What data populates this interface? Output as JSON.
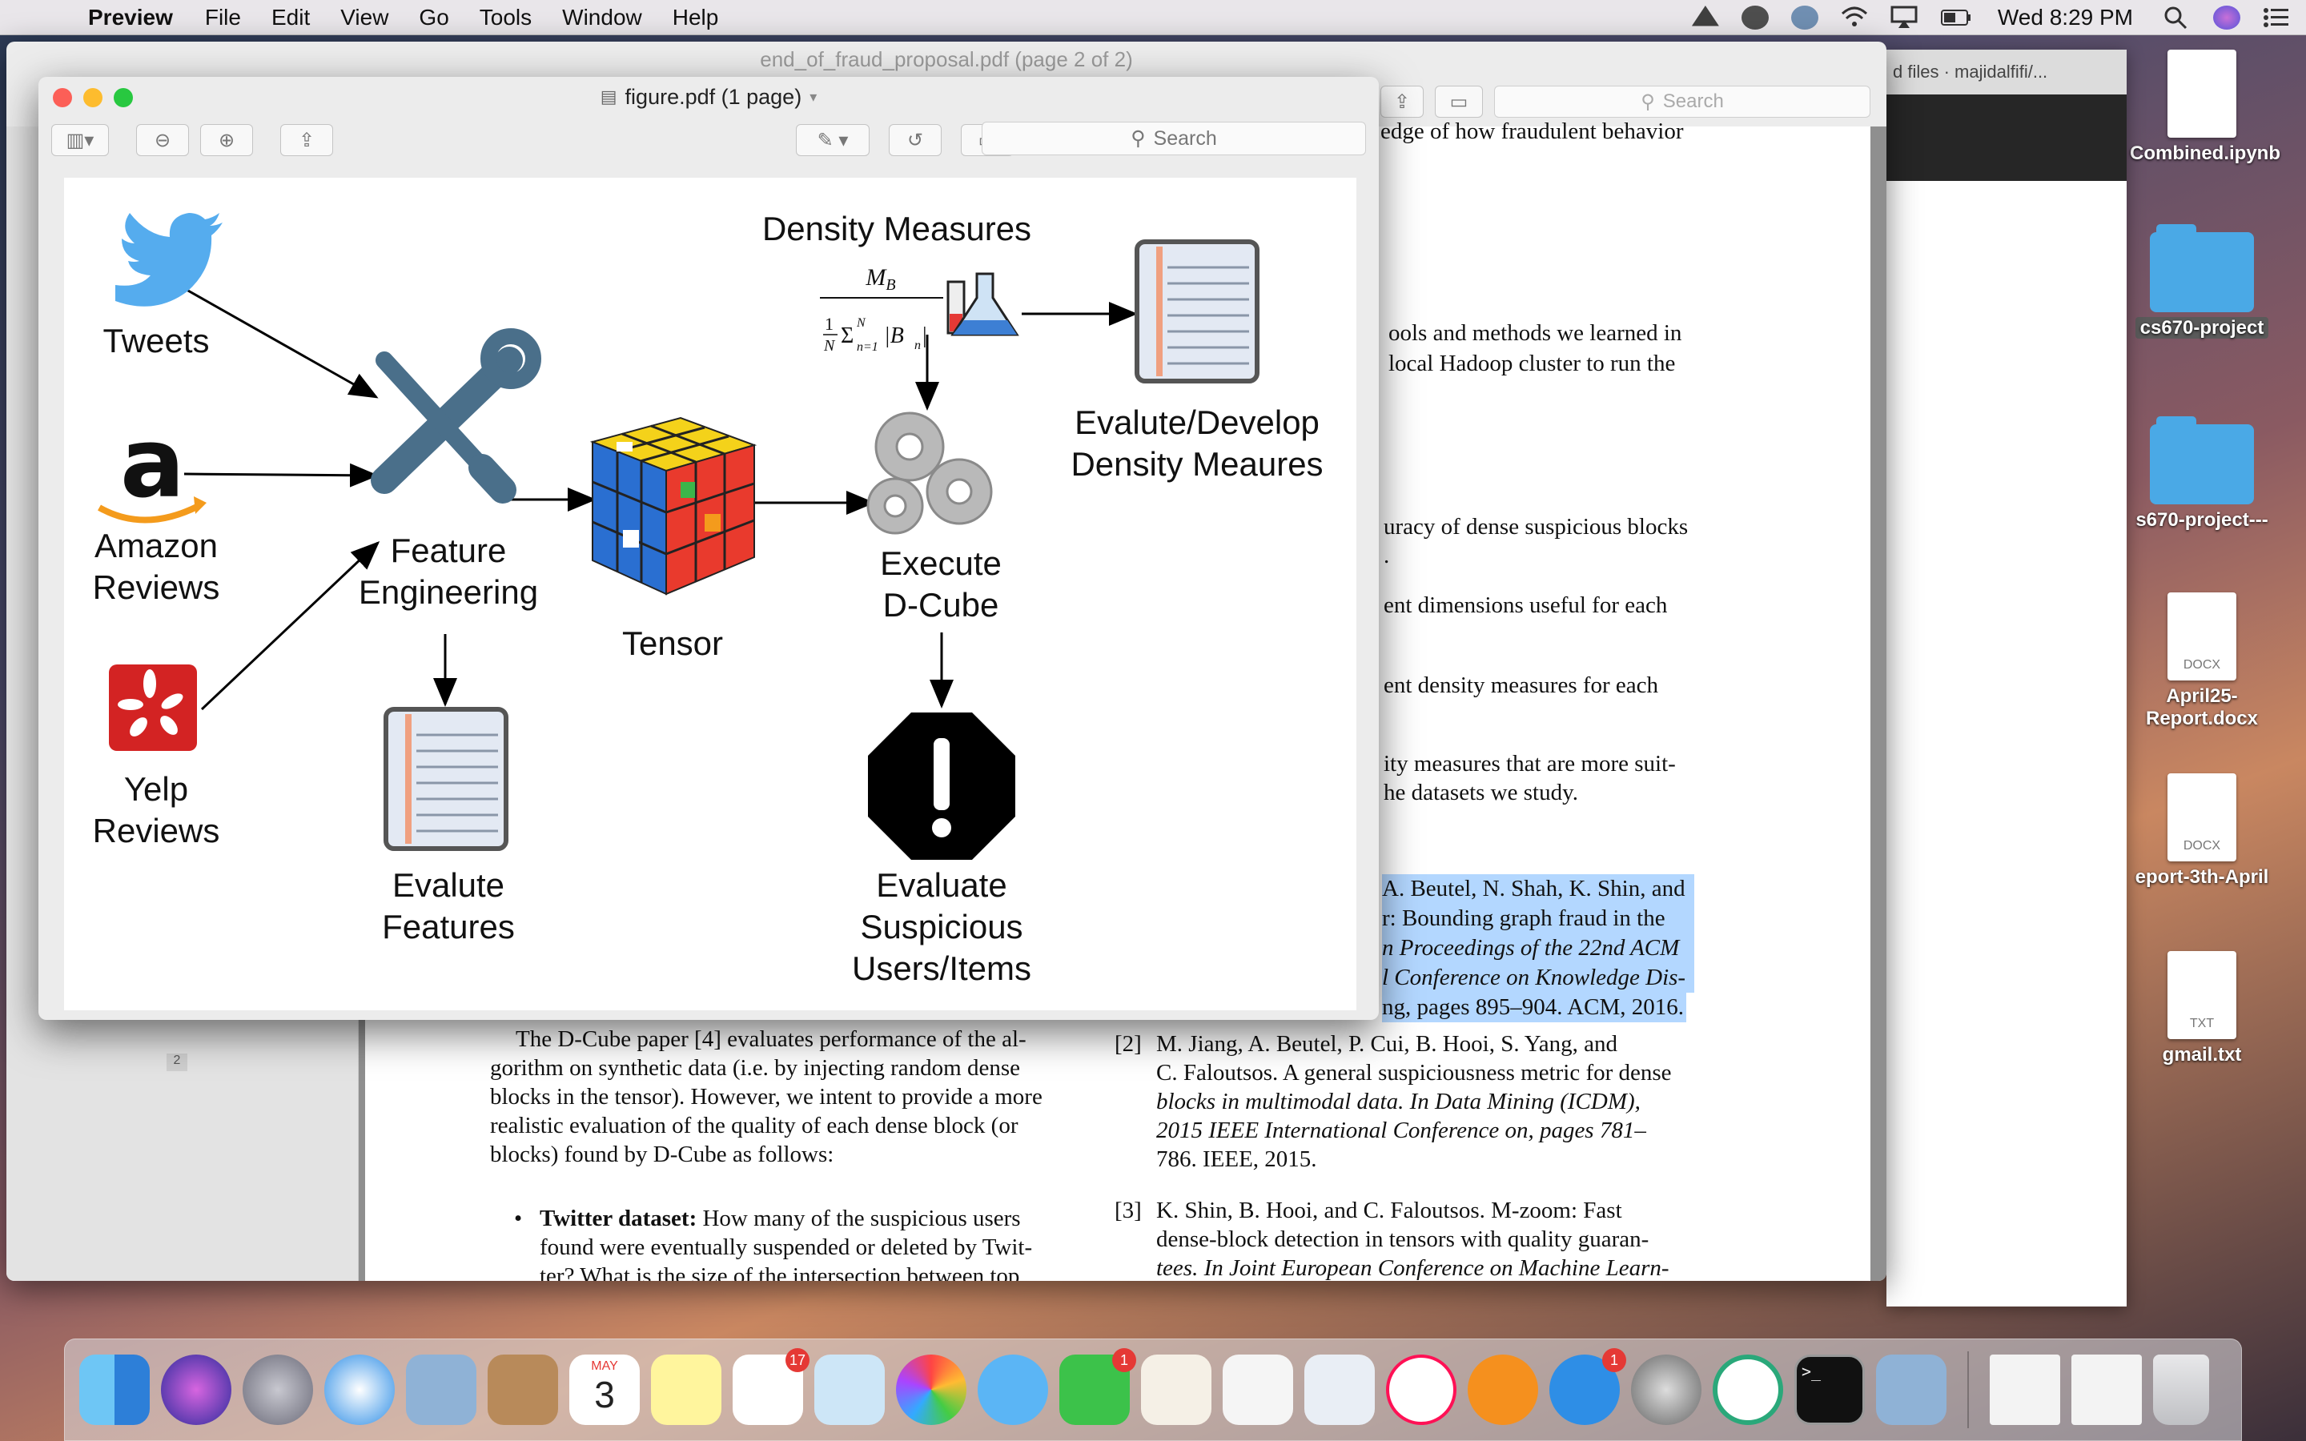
{
  "menubar": {
    "apple": "",
    "app_name": "Preview",
    "menus": [
      "File",
      "Edit",
      "View",
      "Go",
      "Tools",
      "Window",
      "Help"
    ],
    "clock": "Wed 8:29 PM"
  },
  "desktop": {
    "items": [
      {
        "label": "Combined.ipynb",
        "type": "file",
        "badge": ""
      },
      {
        "label": "cs670-project",
        "type": "folder"
      },
      {
        "label": "s670-project---",
        "type": "folder"
      },
      {
        "label": "April25-Report.docx",
        "type": "file",
        "badge": "DOCX"
      },
      {
        "label": "eport-3th-April",
        "type": "file",
        "badge": "DOCX"
      },
      {
        "label": "gmail.txt",
        "type": "file",
        "badge": "TXT"
      }
    ]
  },
  "back_window": {
    "title": "end_of_fraud_proposal.pdf (page 2 of 2)",
    "search_placeholder": "Search",
    "page_number": "2",
    "right_top_lines": [
      "edge of how fraudulent behavior",
      "ools and methods we learned in",
      "local Hadoop cluster to run the",
      "uracy of dense suspicious blocks",
      ".",
      "ent dimensions useful for each",
      "ent density measures for each",
      "ity measures that are more suit-",
      "he datasets we study."
    ],
    "ref1_lines": [
      "A. Beutel, N. Shah, K. Shin, and",
      "r:  Bounding graph fraud in the",
      "n Proceedings of the 22nd ACM",
      "l Conference on Knowledge Dis-",
      "ng, pages 895–904. ACM, 2016."
    ],
    "left_para": [
      "The D-Cube paper [4] evaluates performance of the al-",
      "gorithm on synthetic data (i.e.  by injecting random dense",
      "blocks in the tensor). However, we intent to provide a more",
      "realistic evaluation of the quality of each dense block (or",
      "blocks) found by D-Cube as follows:"
    ],
    "bullet_label": "Twitter dataset:",
    "bullet_lines": [
      " How many of the suspicious users",
      "found were eventually suspended or deleted by Twit-",
      "ter?  What is the size of the intersection between top"
    ],
    "ref2": {
      "num": "[2]",
      "lines": [
        "M. Jiang, A. Beutel, P. Cui, B. Hooi, S. Yang, and",
        "C. Faloutsos. A general suspiciousness metric for dense",
        "blocks in multimodal data.  In Data Mining (ICDM),",
        "2015 IEEE International Conference on, pages 781–",
        "786. IEEE, 2015."
      ]
    },
    "ref3": {
      "num": "[3]",
      "lines": [
        "K. Shin, B. Hooi, and C. Faloutsos.  M-zoom: Fast",
        "dense-block detection in tensors with quality guaran-",
        "tees. In Joint European Conference on Machine Learn-"
      ]
    }
  },
  "browser_fragment": {
    "tab_text": "d files · majidalfifi/..."
  },
  "front_window": {
    "title": "figure.pdf (1 page)",
    "search_placeholder": "Search"
  },
  "figure": {
    "tweets": "Tweets",
    "amazon": [
      "Amazon",
      "Reviews"
    ],
    "yelp": [
      "Yelp",
      "Reviews"
    ],
    "feature_engineering": [
      "Feature",
      "Engineering"
    ],
    "tensor": "Tensor",
    "density_measures": "Density Measures",
    "formula_numerator": "M",
    "formula_num_sub": "B",
    "execute": [
      "Execute",
      "D-Cube"
    ],
    "evalute_develop": [
      "Evalute/Develop",
      "Density Meaures"
    ],
    "evalute_features": [
      "Evalute",
      "Features"
    ],
    "evaluate_suspicious": [
      "Evaluate",
      "Suspicious",
      "Users/Items"
    ]
  },
  "dock": {
    "badges": {
      "reminders": "17",
      "facetime": "1",
      "appstore": "1"
    },
    "calendar_month": "MAY",
    "calendar_day": "3"
  },
  "colors": {
    "selection_highlight": "#b3d7ff",
    "twitter_blue": "#55acee",
    "yelp_red": "#d32323",
    "tool_blue": "#4a6f8a"
  }
}
